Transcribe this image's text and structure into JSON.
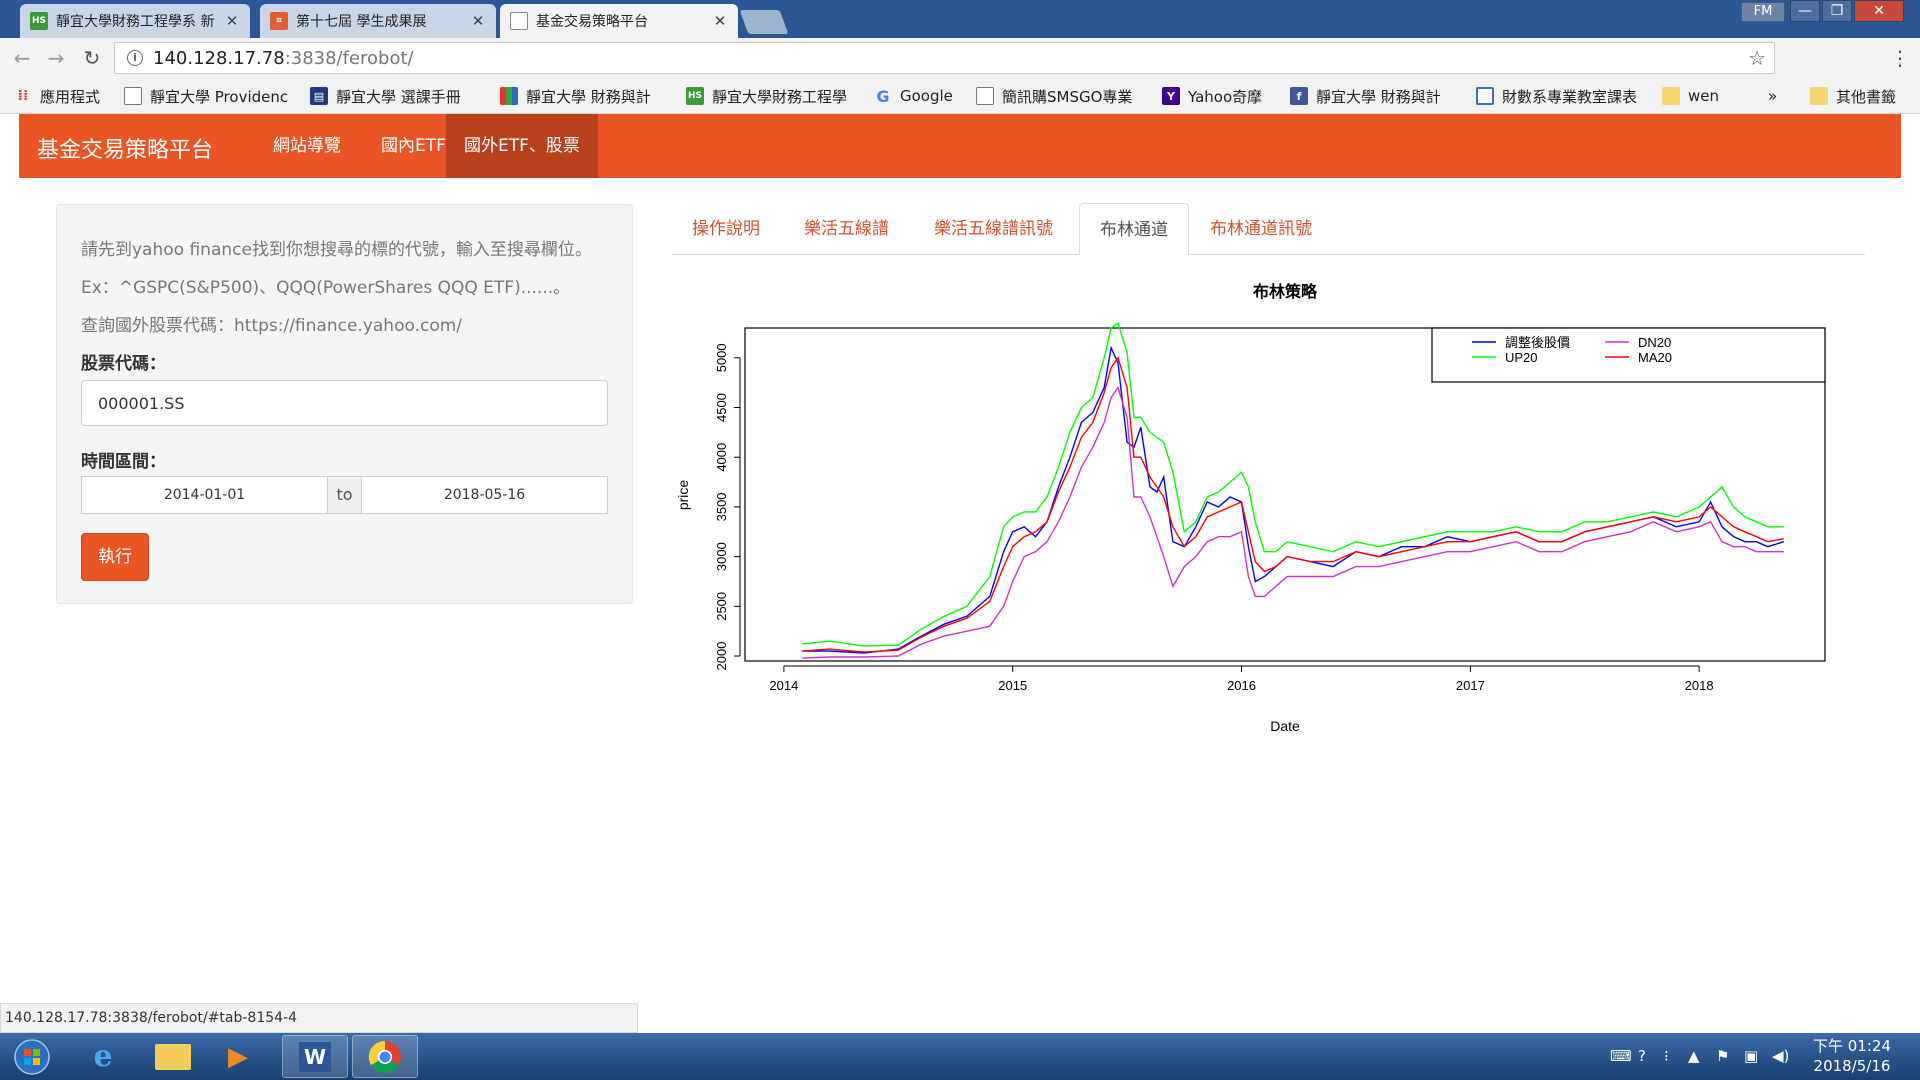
{
  "browser": {
    "tabs": [
      {
        "label": "靜宜大學財務工程學系 新",
        "icon": "hs-icon",
        "active": false
      },
      {
        "label": "第十七屆 學生成果展",
        "icon": "grid-icon",
        "active": false
      },
      {
        "label": "基金交易策略平台",
        "icon": "page-icon",
        "active": true
      }
    ],
    "user_badge": "FM",
    "url_host": "140.128.17.78",
    "url_path": ":3838/ferobot/",
    "bookmarks": [
      {
        "label": "應用程式",
        "icon": "apps-icon"
      },
      {
        "label": "靜宜大學 Providenc",
        "icon": "page-icon"
      },
      {
        "label": "靜宜大學 選課手冊",
        "icon": "book-icon"
      },
      {
        "label": "靜宜大學 財務與計",
        "icon": "blocks-icon"
      },
      {
        "label": "靜宜大學財務工程學",
        "icon": "hs-icon"
      },
      {
        "label": "Google",
        "icon": "google-icon"
      },
      {
        "label": "簡訊購SMSGO專業",
        "icon": "page-icon"
      },
      {
        "label": "Yahoo奇摩",
        "icon": "yahoo-icon"
      },
      {
        "label": "靜宜大學 財務與計",
        "icon": "facebook-icon"
      },
      {
        "label": "財數系專業教室課表",
        "icon": "table-icon"
      },
      {
        "label": "wen",
        "icon": "folder-icon"
      },
      {
        "label": "»",
        "icon": "more-icon"
      },
      {
        "label": "其他書籤",
        "icon": "folder-icon"
      }
    ]
  },
  "navbar": {
    "brand": "基金交易策略平台",
    "links": [
      "網站導覽",
      "國內ETF",
      "國外ETF、股票"
    ],
    "active_index": 2
  },
  "sidebar": {
    "help_lines": [
      "請先到yahoo finance找到你想搜尋的標的代號，輸入至搜尋欄位。",
      "Ex：^GSPC(S&P500)、QQQ(PowerShares QQQ ETF)......。",
      "查詢國外股票代碼：https://finance.yahoo.com/"
    ],
    "symbol_label": "股票代碼：",
    "symbol_value": "000001.SS",
    "date_label": "時間區間：",
    "date_start": "2014-01-01",
    "date_sep": "to",
    "date_end": "2018-05-16",
    "run_label": "執行"
  },
  "tabs": {
    "items": [
      "操作說明",
      "樂活五線譜",
      "樂活五線譜訊號",
      "布林通道",
      "布林通道訊號"
    ],
    "active_index": 3
  },
  "chart_data": {
    "type": "line",
    "title": "布林策略",
    "xlabel": "Date",
    "ylabel": "price",
    "xlim": [
      2013.83,
      2018.55
    ],
    "ylim": [
      1950,
      5300
    ],
    "x_ticks": [
      2014,
      2015,
      2016,
      2017,
      2018
    ],
    "y_ticks": [
      2000,
      2500,
      3000,
      3500,
      4000,
      4500,
      5000
    ],
    "legend_position": "top-right",
    "series": [
      {
        "name": "調整後股價",
        "color": "#0000ff",
        "x": [
          2014.08,
          2014.2,
          2014.35,
          2014.5,
          2014.6,
          2014.7,
          2014.8,
          2014.9,
          2014.96,
          2015.0,
          2015.05,
          2015.1,
          2015.15,
          2015.2,
          2015.25,
          2015.3,
          2015.35,
          2015.4,
          2015.43,
          2015.46,
          2015.5,
          2015.53,
          2015.56,
          2015.6,
          2015.63,
          2015.66,
          2015.7,
          2015.75,
          2015.8,
          2015.85,
          2015.9,
          2015.95,
          2016.0,
          2016.03,
          2016.06,
          2016.1,
          2016.15,
          2016.2,
          2016.3,
          2016.4,
          2016.5,
          2016.6,
          2016.7,
          2016.8,
          2016.9,
          2017.0,
          2017.1,
          2017.2,
          2017.3,
          2017.4,
          2017.5,
          2017.6,
          2017.7,
          2017.8,
          2017.9,
          2018.0,
          2018.05,
          2018.1,
          2018.15,
          2018.2,
          2018.25,
          2018.3,
          2018.37
        ],
        "values": [
          2050,
          2050,
          2030,
          2070,
          2200,
          2320,
          2400,
          2600,
          3050,
          3250,
          3300,
          3200,
          3350,
          3700,
          4000,
          4350,
          4450,
          4700,
          5100,
          4950,
          4150,
          4100,
          4300,
          3700,
          3650,
          3800,
          3150,
          3100,
          3300,
          3550,
          3500,
          3600,
          3550,
          3100,
          2750,
          2800,
          2900,
          3000,
          2950,
          2900,
          3050,
          3000,
          3100,
          3100,
          3200,
          3150,
          3200,
          3250,
          3150,
          3150,
          3250,
          3300,
          3350,
          3400,
          3300,
          3350,
          3550,
          3300,
          3200,
          3150,
          3150,
          3100,
          3150
        ]
      },
      {
        "name": "UP20",
        "color": "#00ff00",
        "x": [
          2014.08,
          2014.2,
          2014.35,
          2014.5,
          2014.6,
          2014.7,
          2014.8,
          2014.9,
          2014.96,
          2015.0,
          2015.05,
          2015.1,
          2015.15,
          2015.2,
          2015.25,
          2015.3,
          2015.35,
          2015.4,
          2015.43,
          2015.46,
          2015.5,
          2015.53,
          2015.56,
          2015.6,
          2015.63,
          2015.66,
          2015.7,
          2015.75,
          2015.8,
          2015.85,
          2015.9,
          2015.95,
          2016.0,
          2016.03,
          2016.06,
          2016.1,
          2016.15,
          2016.2,
          2016.3,
          2016.4,
          2016.5,
          2016.6,
          2016.7,
          2016.8,
          2016.9,
          2017.0,
          2017.1,
          2017.2,
          2017.3,
          2017.4,
          2017.5,
          2017.6,
          2017.7,
          2017.8,
          2017.9,
          2018.0,
          2018.05,
          2018.1,
          2018.15,
          2018.2,
          2018.25,
          2018.3,
          2018.37
        ],
        "values": [
          2120,
          2150,
          2100,
          2110,
          2270,
          2400,
          2500,
          2800,
          3300,
          3400,
          3450,
          3450,
          3600,
          3900,
          4250,
          4500,
          4600,
          5000,
          5300,
          5350,
          5050,
          4400,
          4400,
          4250,
          4200,
          4150,
          3850,
          3250,
          3350,
          3600,
          3650,
          3750,
          3850,
          3700,
          3350,
          3050,
          3050,
          3150,
          3100,
          3050,
          3150,
          3100,
          3150,
          3200,
          3250,
          3250,
          3250,
          3300,
          3250,
          3250,
          3350,
          3350,
          3400,
          3450,
          3400,
          3500,
          3600,
          3700,
          3500,
          3400,
          3350,
          3300,
          3300
        ]
      },
      {
        "name": "DN20",
        "color": "#cc33cc",
        "x": [
          2014.08,
          2014.2,
          2014.35,
          2014.5,
          2014.6,
          2014.7,
          2014.8,
          2014.9,
          2014.96,
          2015.0,
          2015.05,
          2015.1,
          2015.15,
          2015.2,
          2015.25,
          2015.3,
          2015.35,
          2015.4,
          2015.43,
          2015.46,
          2015.5,
          2015.53,
          2015.56,
          2015.6,
          2015.63,
          2015.66,
          2015.7,
          2015.75,
          2015.8,
          2015.85,
          2015.9,
          2015.95,
          2016.0,
          2016.03,
          2016.06,
          2016.1,
          2016.15,
          2016.2,
          2016.3,
          2016.4,
          2016.5,
          2016.6,
          2016.7,
          2016.8,
          2016.9,
          2017.0,
          2017.1,
          2017.2,
          2017.3,
          2017.4,
          2017.5,
          2017.6,
          2017.7,
          2017.8,
          2017.9,
          2018.0,
          2018.05,
          2018.1,
          2018.15,
          2018.2,
          2018.25,
          2018.3,
          2018.37
        ],
        "values": [
          1980,
          1990,
          1990,
          2000,
          2120,
          2200,
          2250,
          2300,
          2500,
          2750,
          3000,
          3050,
          3150,
          3350,
          3600,
          3900,
          4100,
          4350,
          4600,
          4700,
          4400,
          3600,
          3600,
          3400,
          3200,
          3000,
          2700,
          2900,
          3000,
          3150,
          3200,
          3200,
          3250,
          2800,
          2600,
          2600,
          2700,
          2800,
          2800,
          2800,
          2900,
          2900,
          2950,
          3000,
          3050,
          3050,
          3100,
          3150,
          3050,
          3050,
          3150,
          3200,
          3250,
          3350,
          3250,
          3300,
          3350,
          3150,
          3100,
          3100,
          3050,
          3050,
          3050
        ]
      },
      {
        "name": "MA20",
        "color": "#ff0000",
        "x": [
          2014.08,
          2014.2,
          2014.35,
          2014.5,
          2014.6,
          2014.7,
          2014.8,
          2014.9,
          2014.96,
          2015.0,
          2015.05,
          2015.1,
          2015.15,
          2015.2,
          2015.25,
          2015.3,
          2015.35,
          2015.4,
          2015.43,
          2015.46,
          2015.5,
          2015.53,
          2015.56,
          2015.6,
          2015.63,
          2015.66,
          2015.7,
          2015.75,
          2015.8,
          2015.85,
          2015.9,
          2015.95,
          2016.0,
          2016.03,
          2016.06,
          2016.1,
          2016.15,
          2016.2,
          2016.3,
          2016.4,
          2016.5,
          2016.6,
          2016.7,
          2016.8,
          2016.9,
          2017.0,
          2017.1,
          2017.2,
          2017.3,
          2017.4,
          2017.5,
          2017.6,
          2017.7,
          2017.8,
          2017.9,
          2018.0,
          2018.05,
          2018.1,
          2018.15,
          2018.2,
          2018.25,
          2018.3,
          2018.37
        ],
        "values": [
          2050,
          2070,
          2040,
          2060,
          2190,
          2300,
          2380,
          2550,
          2900,
          3100,
          3200,
          3250,
          3350,
          3650,
          3900,
          4200,
          4350,
          4650,
          4900,
          5000,
          4700,
          4000,
          4000,
          3800,
          3700,
          3600,
          3300,
          3100,
          3200,
          3400,
          3450,
          3500,
          3550,
          3250,
          2950,
          2850,
          2900,
          3000,
          2950,
          2950,
          3050,
          3000,
          3050,
          3100,
          3150,
          3150,
          3200,
          3250,
          3150,
          3150,
          3250,
          3300,
          3350,
          3400,
          3350,
          3400,
          3500,
          3400,
          3300,
          3250,
          3200,
          3150,
          3180
        ]
      }
    ]
  },
  "status_url": "140.128.17.78:3838/ferobot/#tab-8154-4",
  "clock": {
    "time": "下午 01:24",
    "date": "2018/5/16"
  },
  "colors": {
    "brand": "#eb5424",
    "brand_dark": "#b8401a",
    "tab_text": "#d6512a"
  }
}
